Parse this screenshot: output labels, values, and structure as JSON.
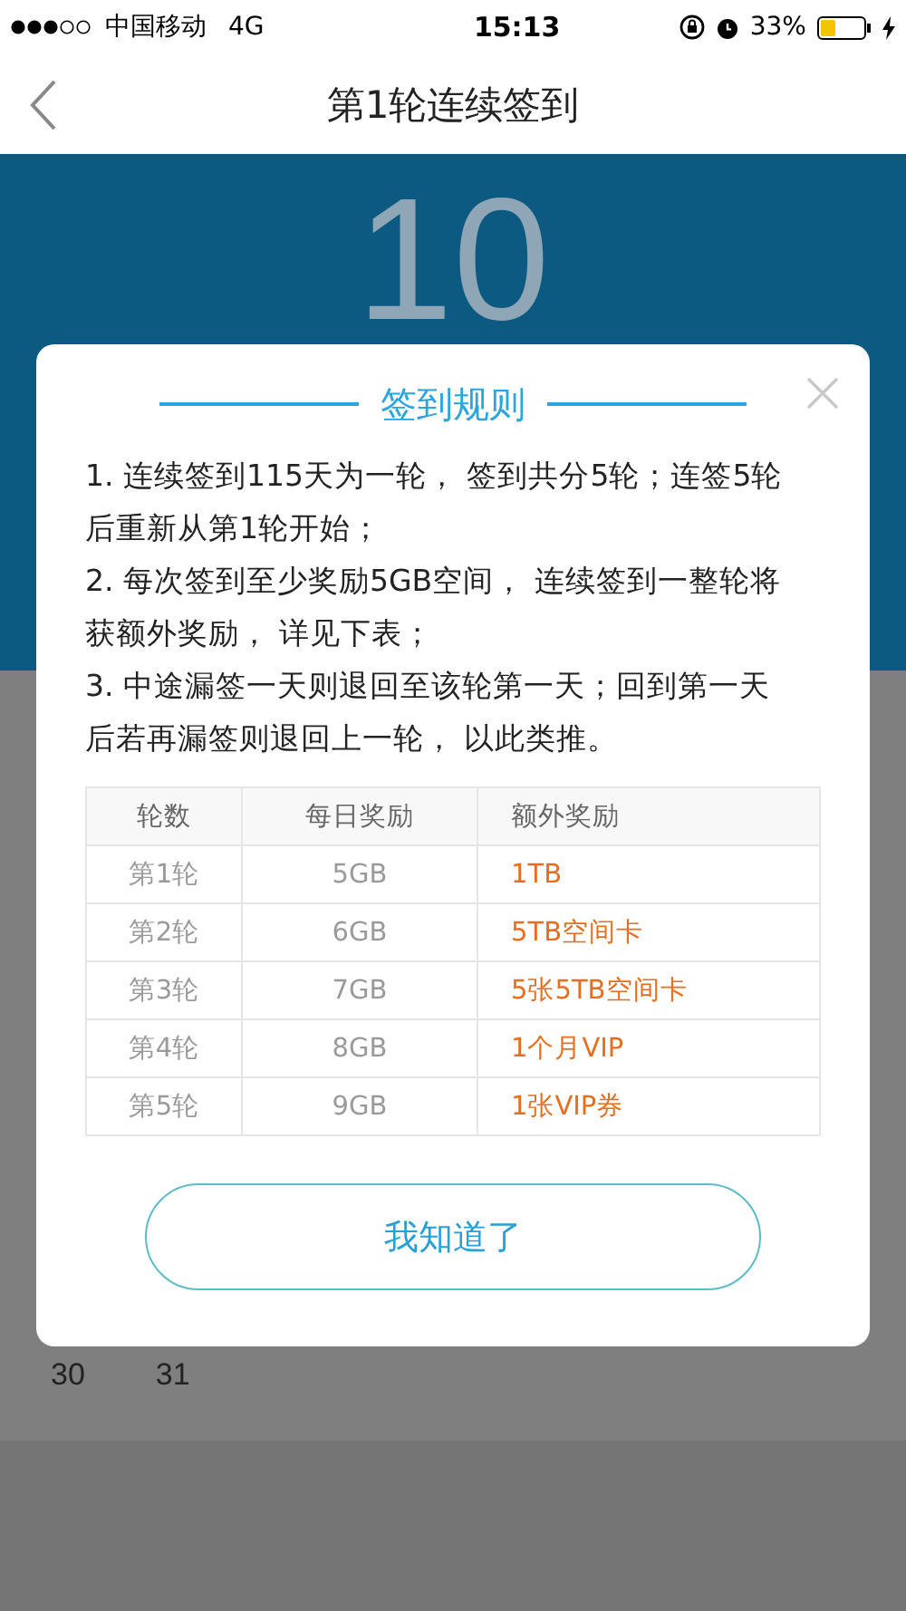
{
  "status_bar": {
    "carrier": "中国移动",
    "network": "4G",
    "time": "15:13",
    "battery": "33%"
  },
  "nav": {
    "title": "第1轮连续签到"
  },
  "streak": {
    "days": "10"
  },
  "calendar": {
    "days": [
      "30",
      "31"
    ]
  },
  "dialog": {
    "title": "签到规则",
    "rules": [
      "1. 连续签到115天为一轮， 签到共分5轮；连签5轮后重新从第1轮开始；",
      "2. 每次签到至少奖励5GB空间， 连续签到一整轮将获额外奖励， 详见下表；",
      "3. 中途漏签一天则退回至该轮第一天；回到第一天后若再漏签则退回上一轮， 以此类推。"
    ],
    "table": {
      "columns": [
        "轮数",
        "每日奖励",
        "额外奖励"
      ],
      "rows": [
        [
          "第1轮",
          "5GB",
          "1TB"
        ],
        [
          "第2轮",
          "6GB",
          "5TB空间卡"
        ],
        [
          "第3轮",
          "7GB",
          "5张5TB空间卡"
        ],
        [
          "第4轮",
          "8GB",
          "1个月VIP"
        ],
        [
          "第5轮",
          "9GB",
          "1张VIP券"
        ]
      ]
    },
    "button": "我知道了"
  }
}
